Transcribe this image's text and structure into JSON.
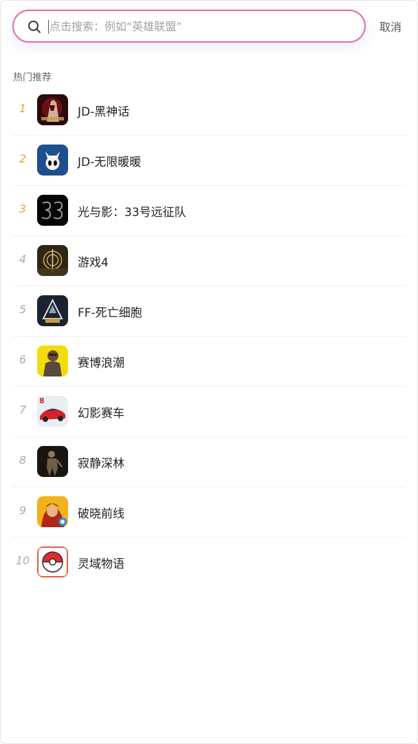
{
  "search": {
    "placeholder": "点击搜索：例如“英雄联盟”",
    "cancel_label": "取消"
  },
  "hot": {
    "title": "热门推荐",
    "items": [
      {
        "rank": "1",
        "name": "JD-黑神话",
        "icon": "game-icon-wukong"
      },
      {
        "rank": "2",
        "name": "JD-无限暖暖",
        "icon": "game-icon-hollow-knight"
      },
      {
        "rank": "3",
        "name": "光与影：33号远征队",
        "icon": "game-icon-33"
      },
      {
        "rank": "4",
        "name": "游戏4",
        "icon": "game-icon-elden-ring"
      },
      {
        "rank": "5",
        "name": "FF-死亡细胞",
        "icon": "game-icon-amg"
      },
      {
        "rank": "6",
        "name": "赛博浪潮",
        "icon": "game-icon-soldier"
      },
      {
        "rank": "7",
        "name": "幻影赛车",
        "icon": "game-icon-racing-car"
      },
      {
        "rank": "8",
        "name": "寂静深林",
        "icon": "game-icon-forest-creature"
      },
      {
        "rank": "9",
        "name": "破晓前线",
        "icon": "game-icon-warrior"
      },
      {
        "rank": "10",
        "name": "灵域物语",
        "icon": "game-icon-pokeball"
      }
    ]
  },
  "colors": {
    "search_border": "#e86aa0",
    "top_rank": "#e9a62b",
    "other_rank": "#a9abb3"
  }
}
